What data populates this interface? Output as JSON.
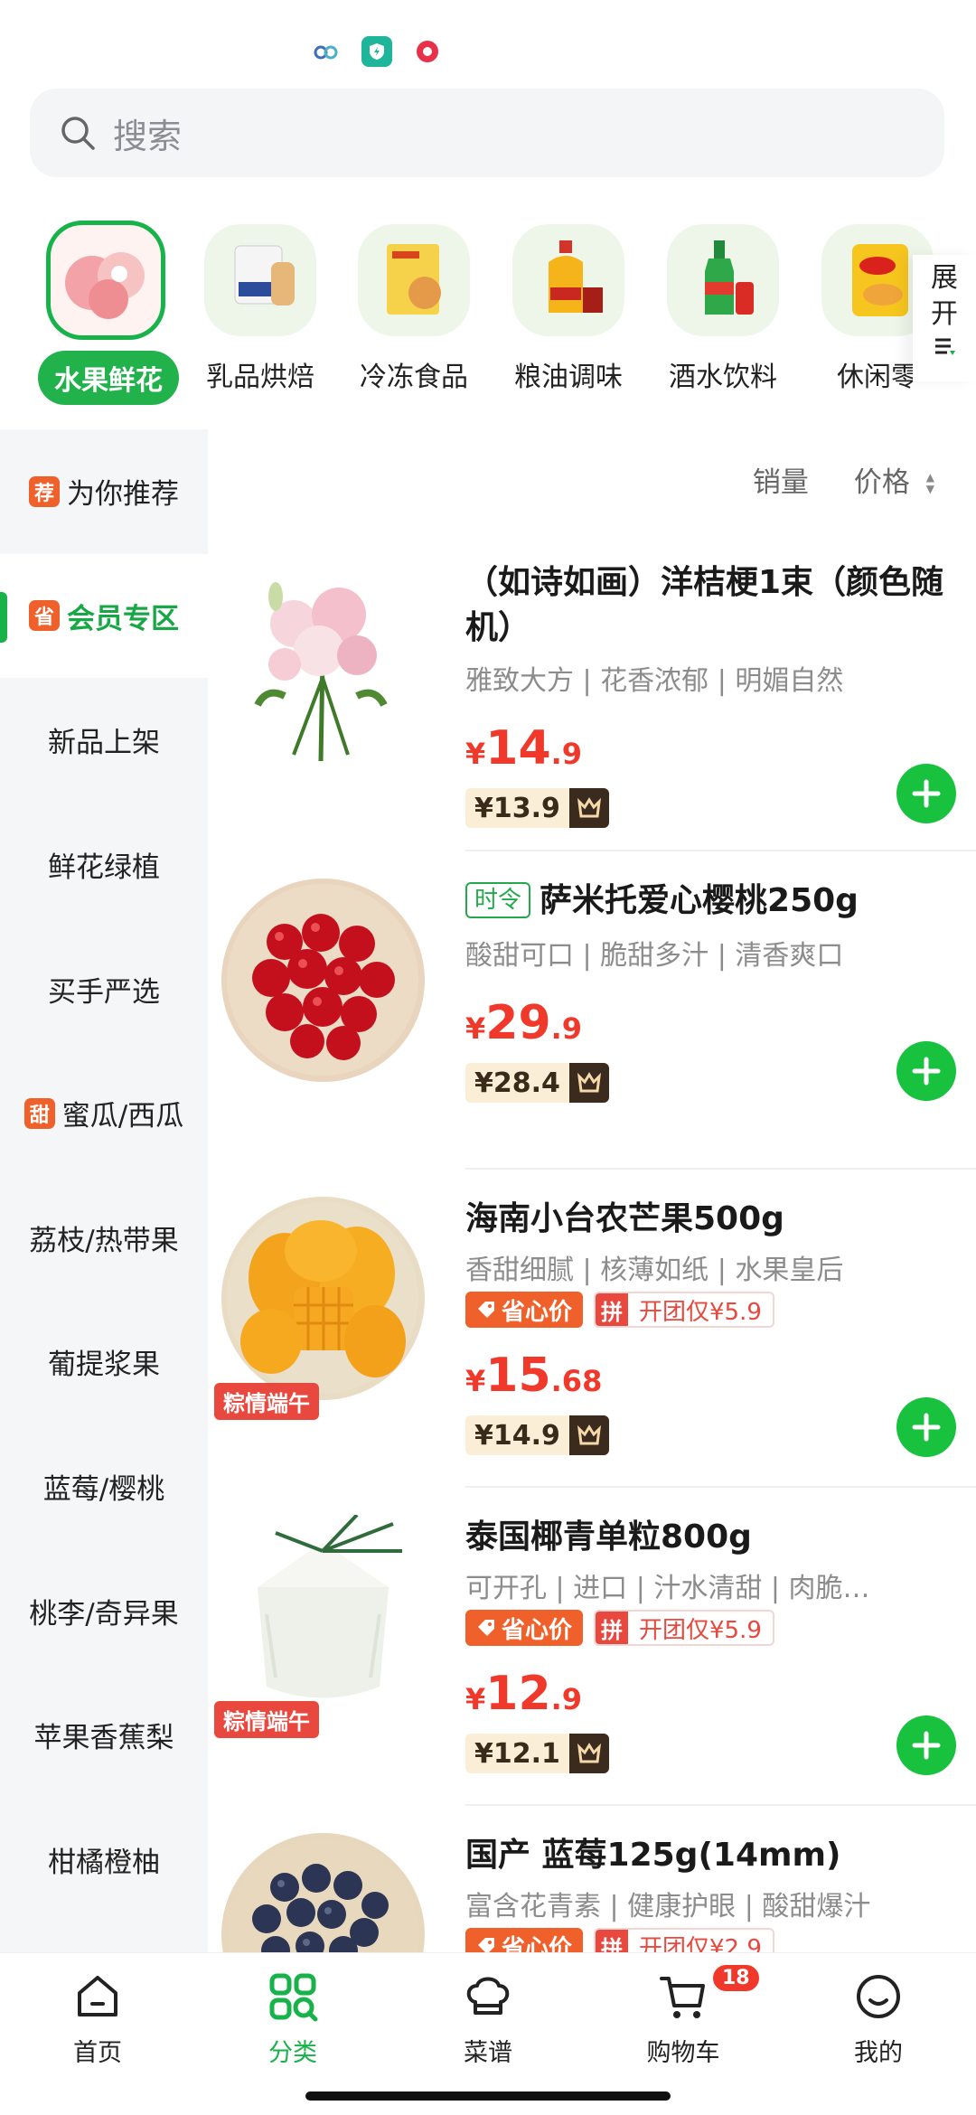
{
  "search": {
    "placeholder": "搜索"
  },
  "categories": [
    {
      "label": "水果鲜花",
      "active": true
    },
    {
      "label": "乳品烘焙"
    },
    {
      "label": "冷冻食品"
    },
    {
      "label": "粮油调味"
    },
    {
      "label": "酒水饮料"
    },
    {
      "label": "休闲零"
    }
  ],
  "expand": {
    "label": "展开"
  },
  "sidebar": [
    {
      "label": "为你推荐",
      "tag": "荐"
    },
    {
      "label": "会员专区",
      "tag": "省",
      "active": true
    },
    {
      "label": "新品上架"
    },
    {
      "label": "鲜花绿植"
    },
    {
      "label": "买手严选"
    },
    {
      "label": "蜜瓜/西瓜",
      "tag": "甜"
    },
    {
      "label": "荔枝/热带果"
    },
    {
      "label": "葡提浆果"
    },
    {
      "label": "蓝莓/樱桃"
    },
    {
      "label": "桃李/奇异果"
    },
    {
      "label": "苹果香蕉梨"
    },
    {
      "label": "柑橘橙柚"
    }
  ],
  "sort": {
    "sales": "销量",
    "price": "价格"
  },
  "products": [
    {
      "title": "（如诗如画）洋桔梗1束（颜色随机）",
      "desc": "雅致大方 | 花香浓郁 | 明媚自然",
      "price_yen": "¥",
      "price_int": "14",
      "price_dec": ".9",
      "member_price": "¥13.9"
    },
    {
      "badge": "时令",
      "title": "萨米托爱心樱桃250g",
      "desc": "酸甜可口 | 脆甜多汁 | 清香爽口",
      "price_yen": "¥",
      "price_int": "29",
      "price_dec": ".9",
      "member_price": "¥28.4"
    },
    {
      "title": "海南小台农芒果500g",
      "desc": "香甜细腻 | 核薄如纸 | 水果皇后",
      "save_tag": "省心价",
      "group_icon": "拼",
      "group_tag": "开团仅¥5.9",
      "ribbon": "粽情端午",
      "price_yen": "¥",
      "price_int": "15",
      "price_dec": ".68",
      "member_price": "¥14.9"
    },
    {
      "title": "泰国椰青单粒800g",
      "desc": "可开孔 | 进口 | 汁水清甜 | 肉脆…",
      "save_tag": "省心价",
      "group_icon": "拼",
      "group_tag": "开团仅¥5.9",
      "ribbon": "粽情端午",
      "price_yen": "¥",
      "price_int": "12",
      "price_dec": ".9",
      "member_price": "¥12.1"
    },
    {
      "title": "国产 蓝莓125g(14mm)",
      "desc": "富含花青素 | 健康护眼 | 酸甜爆汁",
      "save_tag": "省心价",
      "group_icon": "拼",
      "group_tag": "开团仅¥2.9"
    }
  ],
  "tabs": [
    {
      "label": "首页",
      "icon": "home-icon"
    },
    {
      "label": "分类",
      "icon": "category-icon",
      "active": true
    },
    {
      "label": "菜谱",
      "icon": "chef-hat-icon"
    },
    {
      "label": "购物车",
      "icon": "cart-icon",
      "badge": "18"
    },
    {
      "label": "我的",
      "icon": "smile-icon"
    }
  ],
  "colors": {
    "accent_green": "#17b34a",
    "price_red": "#f0392b",
    "tag_orange": "#f0602b"
  }
}
